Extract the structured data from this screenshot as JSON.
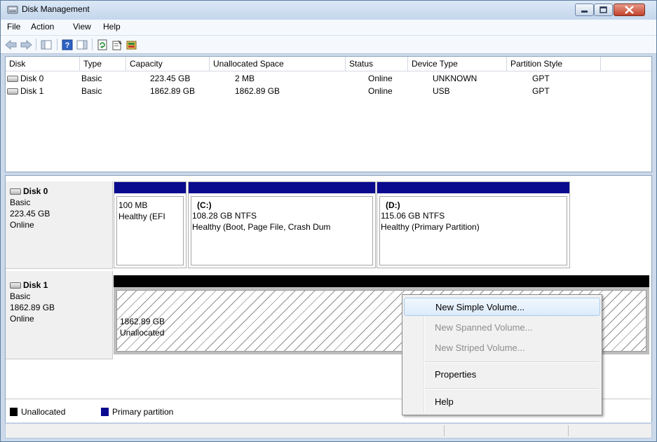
{
  "window": {
    "title": "Disk Management"
  },
  "menu": [
    "File",
    "Action",
    "View",
    "Help"
  ],
  "toolbar": {
    "icons": [
      "back-arrow-icon",
      "forward-arrow-icon",
      "show-hide-console-tree-icon",
      "help-icon",
      "show-hide-action-pane-icon",
      "refresh-icon",
      "properties-icon",
      "rescan-disks-icon"
    ]
  },
  "volume_list": {
    "columns": [
      "Disk",
      "Type",
      "Capacity",
      "Unallocated Space",
      "Status",
      "Device Type",
      "Partition Style"
    ],
    "rows": [
      [
        "Disk 0",
        "Basic",
        "223.45 GB",
        "2 MB",
        "Online",
        "UNKNOWN",
        "GPT"
      ],
      [
        "Disk 1",
        "Basic",
        "1862.89 GB",
        "1862.89 GB",
        "Online",
        "USB",
        "GPT"
      ]
    ]
  },
  "disks": [
    {
      "name": "Disk 0",
      "type": "Basic",
      "size": "223.45 GB",
      "status": "Online",
      "partitions": [
        {
          "label": "",
          "line1": "100 MB",
          "line2": "Healthy (EFI"
        },
        {
          "label": "(C:)",
          "line1": "108.28 GB NTFS",
          "line2": "Healthy (Boot, Page File, Crash Dum"
        },
        {
          "label": "(D:)",
          "line1": "115.06 GB NTFS",
          "line2": "Healthy (Primary Partition)"
        }
      ]
    },
    {
      "name": "Disk 1",
      "type": "Basic",
      "size": "1862.89 GB",
      "status": "Online",
      "partitions": [
        {
          "line1": "1862.89 GB",
          "line2": "Unallocated"
        }
      ]
    }
  ],
  "legend": [
    {
      "label": "Unallocated",
      "color": "#000000"
    },
    {
      "label": "Primary partition",
      "color": "#0a0a8e"
    }
  ],
  "context_menu": {
    "items": [
      {
        "label": "New Simple Volume...",
        "enabled": true,
        "highlighted": true
      },
      {
        "label": "New Spanned Volume...",
        "enabled": false
      },
      {
        "label": "New Striped Volume...",
        "enabled": false
      },
      {
        "label": "Properties",
        "enabled": true
      },
      {
        "label": "Help",
        "enabled": true
      }
    ]
  },
  "colors": {
    "primary_partition": "#0a0a8e",
    "unallocated": "#000000",
    "title_bar": "#c4d6ec",
    "close_button": "#c3422b"
  }
}
